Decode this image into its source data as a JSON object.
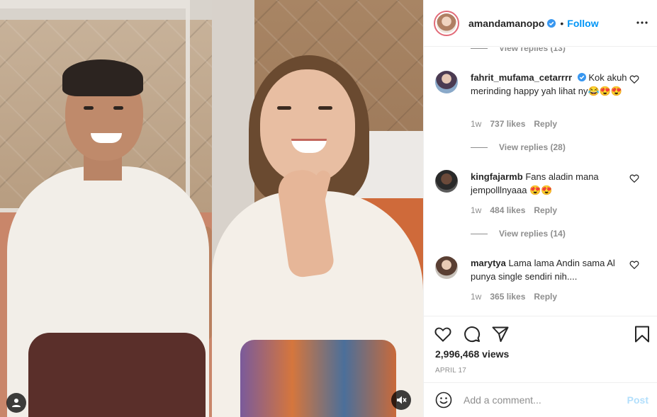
{
  "post": {
    "username": "amandamanopo",
    "verified": true,
    "separator": "•",
    "follow_label": "Follow",
    "more_icon": "more-horizontal-icon"
  },
  "comments": {
    "partial_view_replies": "View replies (13)",
    "items": [
      {
        "username": "fahrit_mufama_cetarrrr",
        "verified": true,
        "text": "Kok akuh merinding happy yah lihat ny😂😍😍",
        "age": "1w",
        "likes": "737 likes",
        "reply_label": "Reply",
        "view_replies": "View replies (28)"
      },
      {
        "username": "kingfajarmb",
        "verified": false,
        "text": "Fans aladin mana jempolllnyaaa 😍😍",
        "age": "1w",
        "likes": "484 likes",
        "reply_label": "Reply",
        "view_replies": "View replies (14)"
      },
      {
        "username": "marytya",
        "verified": false,
        "text": "Lama lama Andin sama Al punya single sendiri nih....",
        "age": "1w",
        "likes": "365 likes",
        "reply_label": "Reply"
      }
    ]
  },
  "actions": {
    "icons": [
      "heart-icon",
      "comment-icon",
      "share-icon",
      "bookmark-icon"
    ],
    "views": "2,996,468 views",
    "date": "APRIL 17"
  },
  "add_comment": {
    "placeholder": "Add a comment...",
    "post_label": "Post"
  },
  "colors": {
    "accent": "#0095f6",
    "post_disabled": "#b2dffc",
    "muted": "#8e8e8e",
    "text": "#262626"
  }
}
